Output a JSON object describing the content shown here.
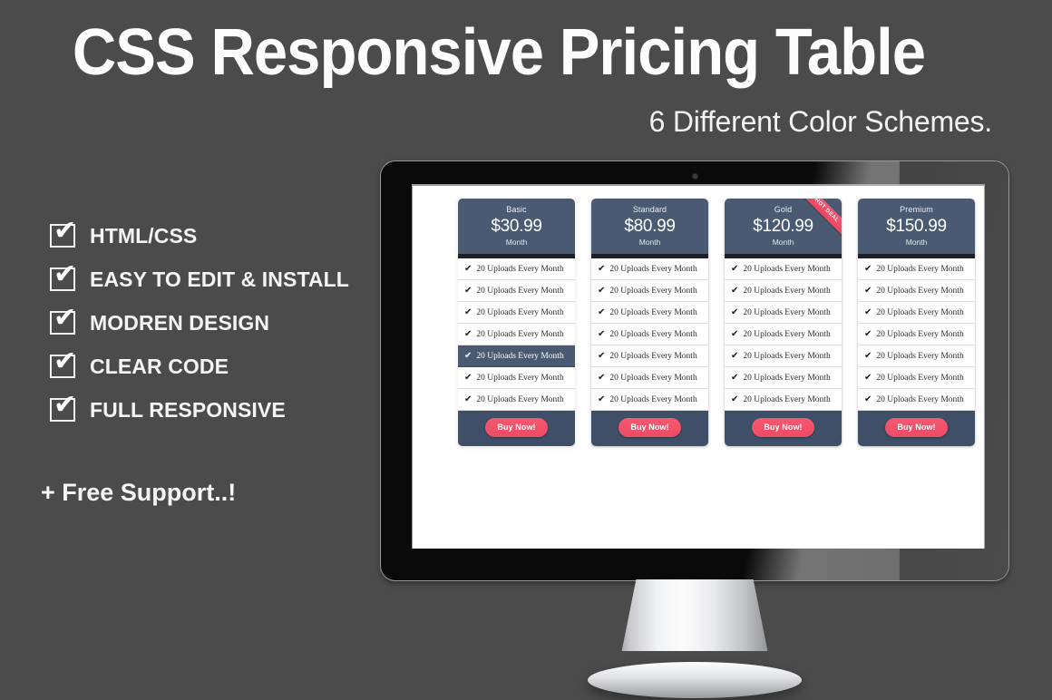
{
  "hero": {
    "title": "CSS Responsive Pricing Table",
    "subtitle": "6 Different Color Schemes."
  },
  "features": {
    "check_icon": "✔",
    "items": [
      {
        "label": "HTML/CSS"
      },
      {
        "label": "EASY TO EDIT & INSTALL"
      },
      {
        "label": "MODREN DESIGN"
      },
      {
        "label": "CLEAR CODE"
      },
      {
        "label": "FULL RESPONSIVE"
      }
    ],
    "support_note": "+ Free Support..!"
  },
  "colors": {
    "background": "#4b4b4b",
    "plan_header": "#4a5a72",
    "plan_footer": "#3f4f67",
    "accent_pink": "#f4596f",
    "divider_dark": "#1d2127"
  },
  "pricing_table": {
    "ribbon_label": "HOT DEAL",
    "buy_label": "Buy Now!",
    "feature_text": "20 Uploads Every Month",
    "feature_check": "✔",
    "feature_rows_per_plan": 7,
    "plans": [
      {
        "name": "Basic",
        "price": "$30.99",
        "period": "Month",
        "featured": true,
        "ribbon": false,
        "active_row_index": 4
      },
      {
        "name": "Standard",
        "price": "$80.99",
        "period": "Month",
        "featured": false,
        "ribbon": false,
        "active_row_index": -1
      },
      {
        "name": "Gold",
        "price": "$120.99",
        "period": "Month",
        "featured": false,
        "ribbon": true,
        "active_row_index": -1
      },
      {
        "name": "Premium",
        "price": "$150.99",
        "period": "Month",
        "featured": false,
        "ribbon": false,
        "active_row_index": -1
      }
    ]
  }
}
